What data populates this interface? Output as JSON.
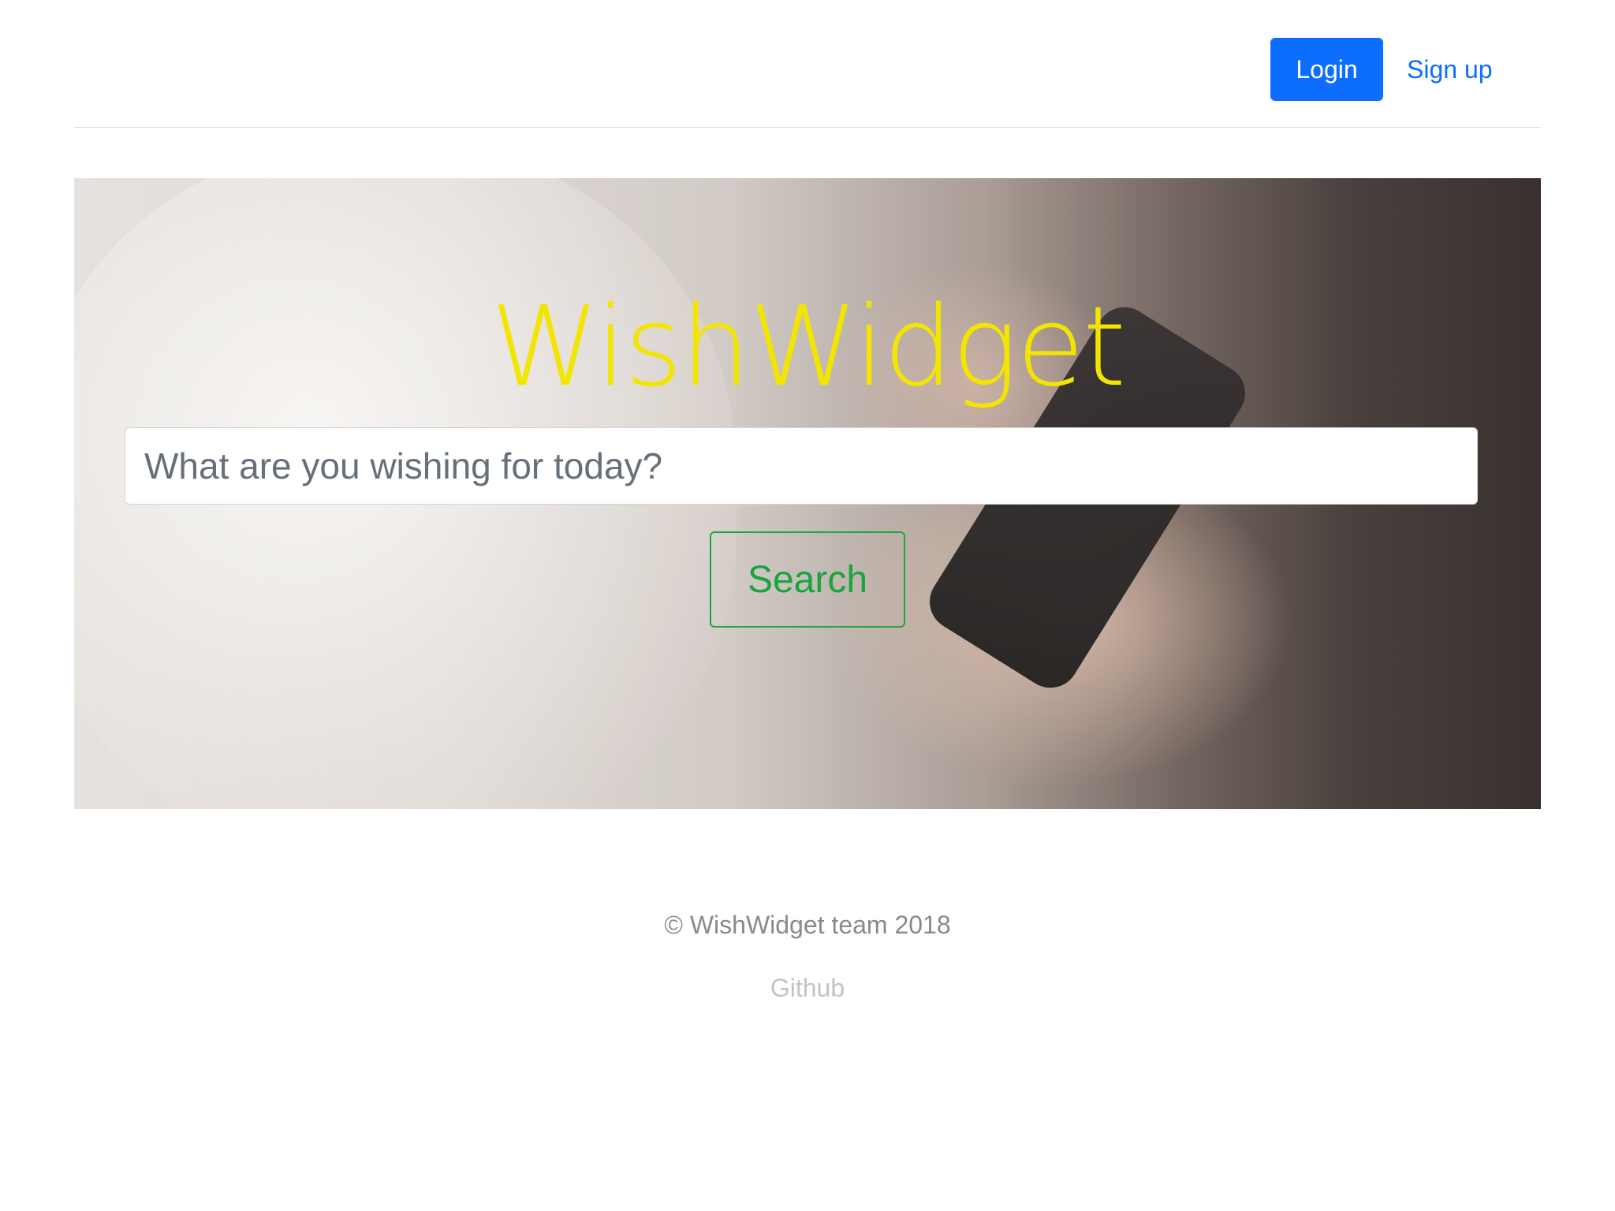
{
  "header": {
    "login_label": "Login",
    "signup_label": "Sign up"
  },
  "hero": {
    "title": "WishWidget",
    "search_placeholder": "What are you wishing for today?",
    "search_button_label": "Search"
  },
  "footer": {
    "copyright": "© WishWidget team 2018",
    "github_label": "Github"
  },
  "colors": {
    "primary": "#0d6efd",
    "title_yellow": "#f2e600",
    "search_green": "#18a43e",
    "footer_text": "#8a8a8a",
    "footer_link": "#c3c3c3"
  }
}
